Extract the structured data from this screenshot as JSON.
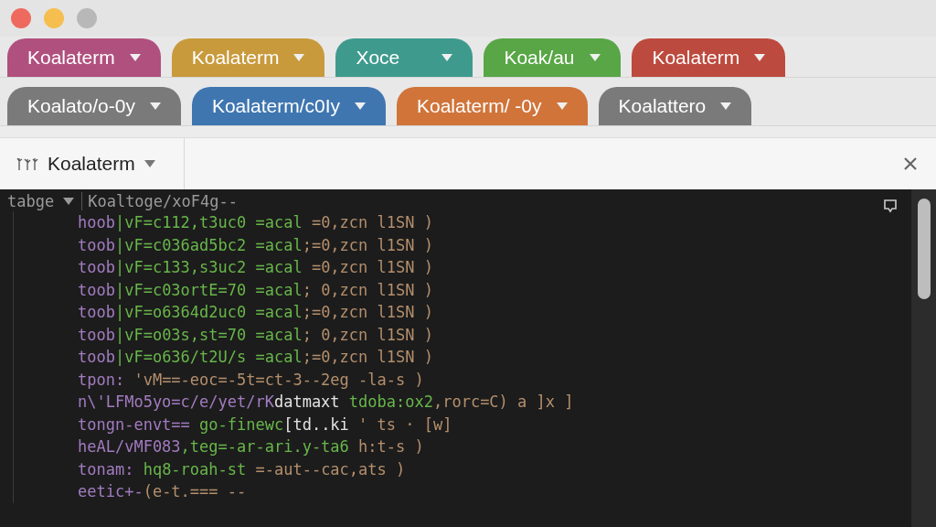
{
  "window_controls": [
    {
      "color": "#ee6a5f"
    },
    {
      "color": "#f5be4f"
    },
    {
      "color": "#b8b8b8"
    }
  ],
  "tab_rows": [
    [
      {
        "label": "Koalaterm",
        "color": "#b0507e"
      },
      {
        "label": "Koalaterm",
        "color": "#c89a3c"
      },
      {
        "label": "Xoce",
        "color": "#3f9a8e"
      },
      {
        "label": "Koak/au",
        "color": "#58a646"
      },
      {
        "label": "Koalaterm",
        "color": "#bd4a3e"
      }
    ],
    [
      {
        "label": "Koalato/o-0y",
        "color": "#7a7a7a"
      },
      {
        "label": "Koalaterm/c0Iy",
        "color": "#3f76b0"
      },
      {
        "label": "Koalaterm/ -0y",
        "color": "#d0743a"
      },
      {
        "label": "Koalattero",
        "color": "#7a7a7a"
      }
    ]
  ],
  "session": {
    "label": "Koalaterm"
  },
  "terminal": {
    "header": {
      "menu": "tabge",
      "path": "Koaltoge/xoF4g--"
    },
    "lines": [
      [
        {
          "kind": "keyword",
          "text": "hoob"
        },
        {
          "kind": "string",
          "text": "|vF=c112,t3uc0 =acal"
        },
        {
          "kind": "comment",
          "text": " =0,zcn l1SN )"
        }
      ],
      [
        {
          "kind": "keyword",
          "text": "toob"
        },
        {
          "kind": "string",
          "text": "|vF=c036ad5bc2 =acal"
        },
        {
          "kind": "comment",
          "text": ";=0,zcn l1SN )"
        }
      ],
      [
        {
          "kind": "keyword",
          "text": "toob"
        },
        {
          "kind": "string",
          "text": "|vF=c133,s3uc2 =acal"
        },
        {
          "kind": "comment",
          "text": " =0,zcn l1SN )"
        }
      ],
      [
        {
          "kind": "keyword",
          "text": "toob"
        },
        {
          "kind": "string",
          "text": "|vF=c03ortE=70 =acal"
        },
        {
          "kind": "comment",
          "text": "; 0,zcn l1SN )"
        }
      ],
      [
        {
          "kind": "keyword",
          "text": "toob"
        },
        {
          "kind": "string",
          "text": "|vF=o6364d2uc0 =acal"
        },
        {
          "kind": "comment",
          "text": ";=0,zcn l1SN )"
        }
      ],
      [
        {
          "kind": "keyword",
          "text": "toob"
        },
        {
          "kind": "string",
          "text": "|vF=o03s,st=70 =acal"
        },
        {
          "kind": "comment",
          "text": "; 0,zcn l1SN )"
        }
      ],
      [
        {
          "kind": "keyword",
          "text": "toob"
        },
        {
          "kind": "string",
          "text": "|vF=o636/t2U/s =acal"
        },
        {
          "kind": "comment",
          "text": ";=0,zcn l1SN )"
        }
      ],
      [
        {
          "kind": "keyword",
          "text": "tpon:"
        },
        {
          "kind": "comment",
          "text": " 'vM==-eoc=-5t=ct-3--2eg -la-s )"
        }
      ],
      [
        {
          "kind": "keyword",
          "text": "n\\'LFMo5yo=c/e/yet/rK"
        },
        {
          "kind": "plain",
          "text": "datmaxt"
        },
        {
          "kind": "string",
          "text": " tdoba:ox2"
        },
        {
          "kind": "comment",
          "text": ",rorc=C) a ]x ]"
        }
      ],
      [
        {
          "kind": "keyword",
          "text": "tongn-envt=="
        },
        {
          "kind": "string",
          "text": " go-finewc"
        },
        {
          "kind": "plain",
          "text": "[td..ki"
        },
        {
          "kind": "comment",
          "text": " ' ts · [w]"
        }
      ],
      [
        {
          "kind": "keyword",
          "text": "heAL/vMF083"
        },
        {
          "kind": "string",
          "text": ",teg=-ar-ari.y-ta6"
        },
        {
          "kind": "comment",
          "text": " h:t-s )"
        }
      ],
      [
        {
          "kind": "keyword",
          "text": "tonam:"
        },
        {
          "kind": "string",
          "text": " hq8-roah-st"
        },
        {
          "kind": "comment",
          "text": " =-aut--cac,ats )"
        }
      ],
      [
        {
          "kind": "keyword",
          "text": "eetic+-"
        },
        {
          "kind": "comment",
          "text": "(e-t.=== --"
        }
      ]
    ]
  }
}
